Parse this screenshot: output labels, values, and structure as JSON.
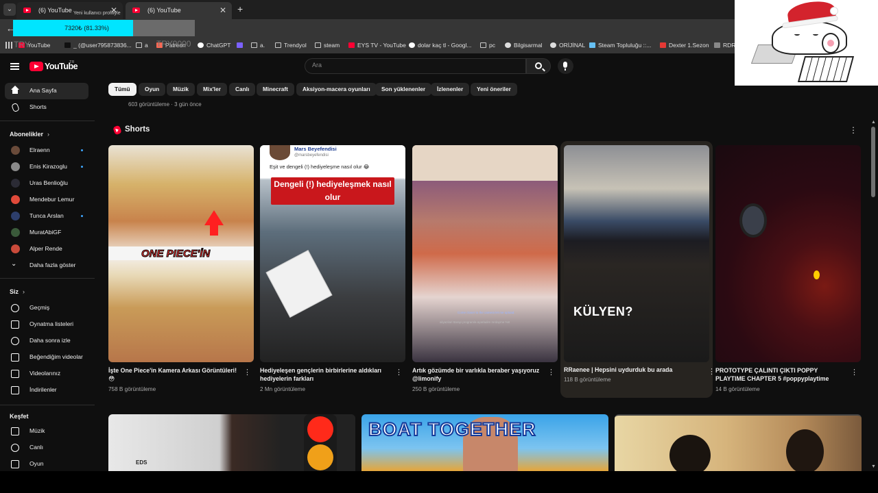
{
  "browser": {
    "tabs": [
      {
        "title": "(6) YouTube"
      },
      {
        "title": "(6) YouTube"
      }
    ],
    "tab_tooltip": "Yeni kullanıcı profiliyle",
    "new_tab_symbol": "+",
    "close_symbol": "✕",
    "download_overlay": {
      "text": "7320₺ (81.33%)",
      "percent": 81.33
    },
    "ghost_left": "TRY",
    "ghost_mid": "TRY9000",
    "bookmarks": [
      {
        "label": "YouTube",
        "icon": "youtube-icon",
        "color": "#ff0033"
      },
      {
        "label": "_ (@user795873836...",
        "icon": "tiktok-icon",
        "color": "#111111"
      },
      {
        "label": "a",
        "icon": "folder-icon",
        "color": ""
      },
      {
        "label": "Patreon",
        "icon": "patreon-icon",
        "color": "#f96854"
      },
      {
        "label": "ChatGPT",
        "icon": "chatgpt-icon",
        "color": "#ffffff"
      },
      {
        "label": "",
        "icon": "feather-icon",
        "color": "#7b61ff"
      },
      {
        "label": "a.",
        "icon": "folder-icon",
        "color": ""
      },
      {
        "label": "Trendyol",
        "icon": "folder-icon",
        "color": ""
      },
      {
        "label": "steam",
        "icon": "folder-icon",
        "color": ""
      },
      {
        "label": "EYS TV - YouTube",
        "icon": "youtube-icon",
        "color": "#ff0033"
      },
      {
        "label": "dolar kaç tl - Googl...",
        "icon": "google-icon",
        "color": "#ffffff"
      },
      {
        "label": "pc",
        "icon": "folder-icon",
        "color": ""
      },
      {
        "label": "Bilgisarmal",
        "icon": "globe-icon",
        "color": "#dddddd"
      },
      {
        "label": "ORİJİNAL",
        "icon": "globe-icon",
        "color": "#dddddd"
      },
      {
        "label": "Steam Topluluğu ::...",
        "icon": "steam-icon",
        "color": "#66c0f4"
      },
      {
        "label": "Dexter 1.Sezon",
        "icon": "dexter-icon",
        "color": "#e53935"
      },
      {
        "label": "RDR",
        "icon": "rdr-icon",
        "color": "#888888"
      }
    ],
    "bookmarks_more": "»",
    "menu_dots": "⋮"
  },
  "masthead": {
    "logo_text": "YouTube",
    "region": "TR",
    "search_placeholder": "Ara"
  },
  "sidebar": {
    "main": [
      {
        "label": "Ana Sayfa",
        "icon": "home-icon",
        "active": true
      },
      {
        "label": "Shorts",
        "icon": "shorts-icon",
        "active": false
      }
    ],
    "subscriptions_title": "Abonelikler",
    "subscriptions": [
      {
        "label": "Elraenn",
        "avatar_color": "#6a4b3a",
        "live": true
      },
      {
        "label": "Enis Kirazoglu",
        "avatar_color": "#8a8a8a",
        "live": true
      },
      {
        "label": "Uras Benlioğlu",
        "avatar_color": "#2b2b35",
        "live": false
      },
      {
        "label": "Mendebur Lemur",
        "avatar_color": "#e04a3a",
        "live": false
      },
      {
        "label": "Tunca Arslan",
        "avatar_color": "#2d3e6b",
        "live": true
      },
      {
        "label": "MuratAbiGF",
        "avatar_color": "#3a5a3a",
        "live": false
      },
      {
        "label": "Alper Rende",
        "avatar_color": "#c94a3a",
        "live": false
      }
    ],
    "show_more": "Daha fazla göster",
    "you_title": "Siz",
    "you_items": [
      {
        "label": "Geçmiş",
        "icon": "history-icon"
      },
      {
        "label": "Oynatma listeleri",
        "icon": "playlist-icon"
      },
      {
        "label": "Daha sonra izle",
        "icon": "clock-icon"
      },
      {
        "label": "Beğendiğim videolar",
        "icon": "thumbs-up-icon"
      },
      {
        "label": "Videolarınız",
        "icon": "video-icon"
      },
      {
        "label": "İndirilenler",
        "icon": "download-icon"
      }
    ],
    "explore_title": "Keşfet",
    "explore_items": [
      {
        "label": "Müzik",
        "icon": "music-icon"
      },
      {
        "label": "Canlı",
        "icon": "live-icon"
      },
      {
        "label": "Oyun",
        "icon": "gaming-icon"
      }
    ]
  },
  "chips": [
    "Tümü",
    "Oyun",
    "Müzik",
    "Mix'ler",
    "Canlı",
    "Minecraft",
    "Aksiyon-macera oyunları",
    "Son yüklenenler",
    "İzlenenler",
    "Yeni öneriler"
  ],
  "previous_meta": "603 görüntüleme · 3 gün önce",
  "shorts": {
    "title": "Shorts",
    "items": [
      {
        "title": "İşte One Piece'in Kamera Arkası Görüntüleri! 😳",
        "views": "758 B görüntüleme",
        "overlay": "ONE PIECE'İN"
      },
      {
        "title": "Hediyeleşen gençlerin birbirlerine aldıkları hediyelerin farkları",
        "views": "2 Mn görüntüleme",
        "overlay_channel": "Mars Beyefendisi",
        "overlay_handle": "@marsbeyefendisi",
        "overlay_caption": "Eşit ve dengeli (!) hediyeleşme nasıl olur 😂",
        "overlay_box": "Dengeli (!) hediyeleşmek nasıl olur"
      },
      {
        "title": "Artık gözümde bir varlıkla beraber yaşıyoruz @limonify",
        "views": "250 B görüntüleme",
        "overlay_sub": "Come closer to the camera let me upload.",
        "overlay_sub2": "aliyazilari ttarayi programla ayarladim mrdayme %8"
      },
      {
        "title": "RRaenee | Hepsini uydurduk bu arada",
        "views": "118 B görüntüleme",
        "overlay": "KÜLYEN?"
      },
      {
        "title": "PROTOTYPE ÇALINTI ÇIKTI POPPY PLAYTIME CHAPTER 5 #poppyplaytime",
        "views": "14 B görüntüleme"
      }
    ]
  },
  "bottom_row": {
    "thumb1_label": "EDS",
    "thumb2_label": "BOAT TOGETHER"
  }
}
